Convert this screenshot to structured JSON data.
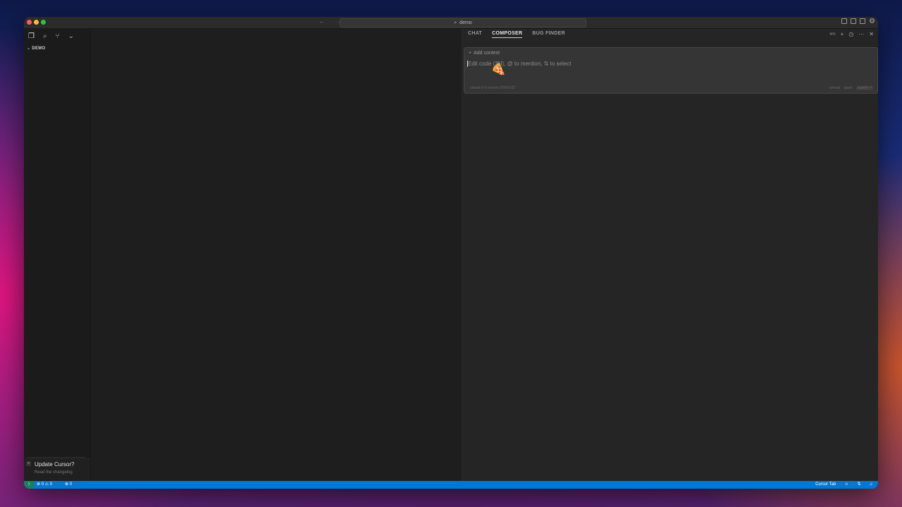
{
  "titlebar": {
    "nav_arrows": "← →",
    "search_label": "demo"
  },
  "sidebar": {
    "icons": [
      "files-icon",
      "search-icon",
      "source-control-icon",
      "chevron-down-icon"
    ],
    "explorer_title": "DEMO"
  },
  "toast": {
    "title": "Update Cursor?",
    "subtitle": "Read the changelog"
  },
  "panel": {
    "tabs": [
      {
        "label": "CHAT"
      },
      {
        "label": "COMPOSER",
        "active": true
      },
      {
        "label": "BUG FINDER"
      }
    ],
    "new_shortcut": "⌘N"
  },
  "composer": {
    "add_context": "Add context",
    "placeholder": "Edit code (⌘I), @ to mention, ⇅ to select",
    "model": "claude-3-5-sonnet-20241022",
    "mode": "normal",
    "agent": "agent",
    "submit": "submit ⏎"
  },
  "statusbar": {
    "problems": "⊗ 0 ⚠ 0",
    "ports": "⊗ 0",
    "cursor_tab": "Cursor Tab"
  },
  "colors": {
    "statusbar_bg": "#0078d4",
    "remote_bg": "#16825d",
    "panel_bg": "#252525",
    "editor_bg": "#1e1e1e"
  }
}
